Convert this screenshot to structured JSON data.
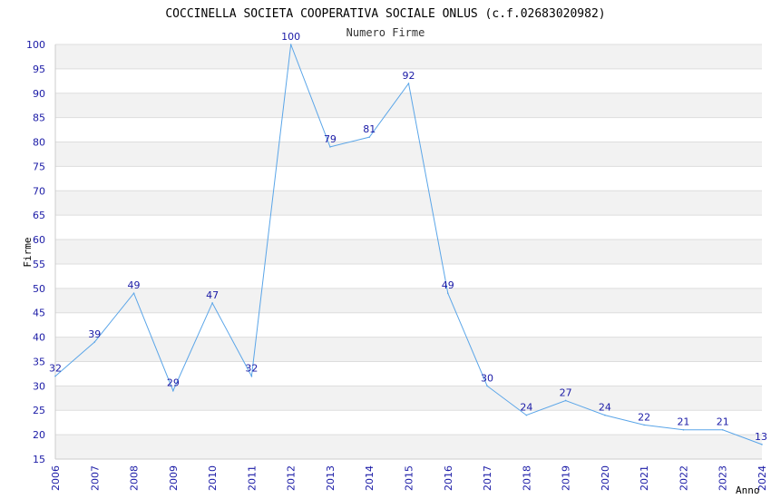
{
  "chart_data": {
    "type": "line",
    "title": "COCCINELLA SOCIETA COOPERATIVA SOCIALE ONLUS (c.f.02683020982)",
    "subtitle": "Numero Firme",
    "xlabel": "Anno",
    "ylabel": "Firme",
    "x": [
      "2006",
      "2007",
      "2008",
      "2009",
      "2010",
      "2011",
      "2012",
      "2013",
      "2014",
      "2015",
      "2016",
      "2017",
      "2018",
      "2019",
      "2020",
      "2021",
      "2022",
      "2023",
      "2024"
    ],
    "series": [
      {
        "values": [
          32,
          39,
          49,
          29,
          47,
          32,
          100,
          79,
          81,
          92,
          49,
          30,
          24,
          27,
          24,
          22,
          21,
          21,
          18
        ]
      }
    ],
    "data_labels": [
      "32",
      "39",
      "49",
      "29",
      "47",
      "32",
      "100",
      "79",
      "81",
      "92",
      "49",
      "30",
      "24",
      "27",
      "24",
      "22",
      "21",
      "21",
      "13"
    ],
    "ylim": [
      15,
      100
    ],
    "yticks": [
      15,
      20,
      25,
      30,
      35,
      40,
      45,
      50,
      55,
      60,
      65,
      70,
      75,
      80,
      85,
      90,
      95,
      100
    ],
    "grid": true,
    "colors": {
      "line": "#5aa5e8",
      "band": "#f2f2f2",
      "gridline": "#dddddd",
      "tick_text": "#1a1aa6"
    }
  }
}
